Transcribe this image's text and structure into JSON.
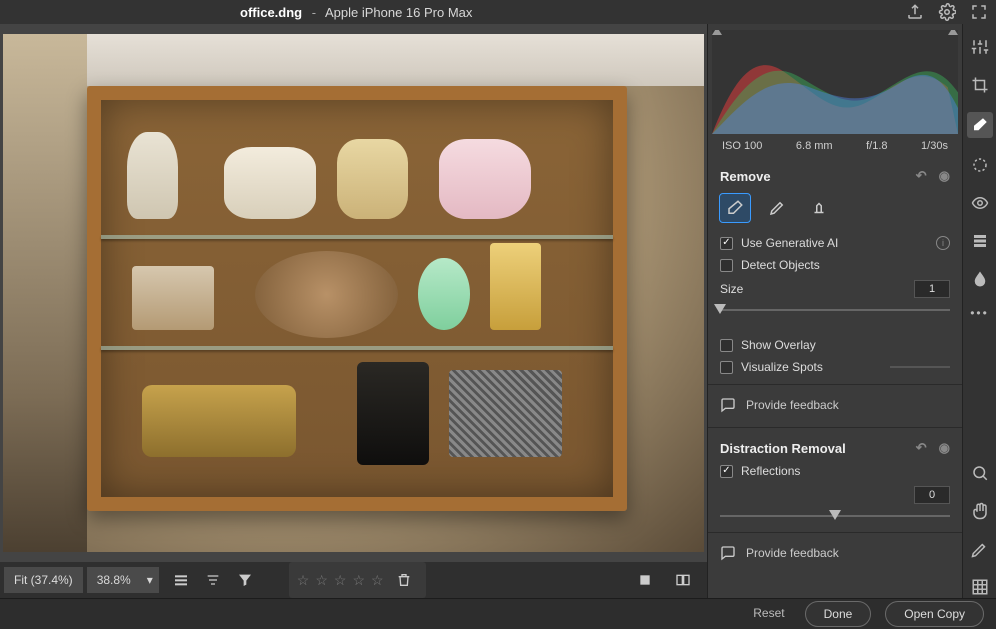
{
  "title": {
    "filename": "office.dng",
    "separator": "-",
    "device": "Apple iPhone 16 Pro Max"
  },
  "exif": {
    "iso": "ISO 100",
    "focal": "6.8 mm",
    "aperture": "f/1.8",
    "shutter": "1/30s"
  },
  "panel": {
    "remove": {
      "heading": "Remove",
      "use_gen_ai": {
        "label": "Use Generative AI",
        "checked": true
      },
      "detect_objects": {
        "label": "Detect Objects",
        "checked": false
      },
      "size": {
        "label": "Size",
        "value": "1",
        "pos": 0
      },
      "show_overlay": {
        "label": "Show Overlay",
        "checked": false
      },
      "visualize_spots": {
        "label": "Visualize Spots",
        "checked": false
      },
      "feedback": "Provide feedback"
    },
    "distraction": {
      "heading": "Distraction Removal",
      "reflections": {
        "label": "Reflections",
        "checked": true
      },
      "amount": {
        "value": "0",
        "pos": 50
      },
      "feedback": "Provide feedback"
    }
  },
  "viewer": {
    "fit_label": "Fit (37.4%)",
    "zoom": "38.8%"
  },
  "footer": {
    "reset": "Reset",
    "done": "Done",
    "open": "Open Copy"
  }
}
